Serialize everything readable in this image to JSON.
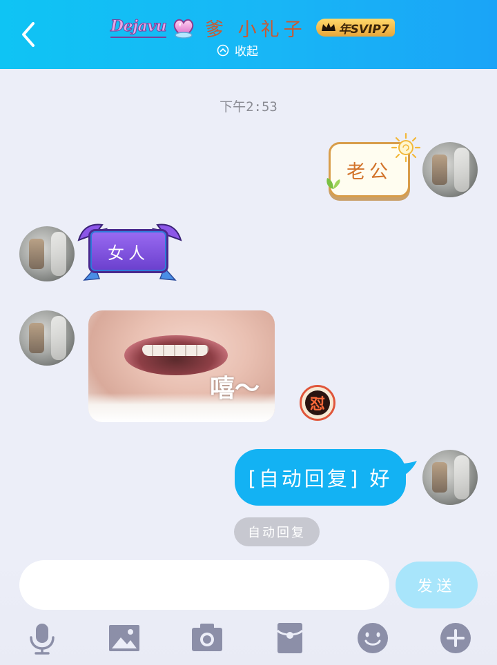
{
  "header": {
    "badge_text": "Dejavu",
    "contact_name": "爹 小礼子",
    "svip_label": "年SVIP7",
    "collapse_label": "收起"
  },
  "chat": {
    "timestamp": "下午2:53",
    "messages": [
      {
        "side": "right",
        "type": "sticker-bubble",
        "text": "老公"
      },
      {
        "side": "left",
        "type": "sticker-bubble",
        "text": "女人"
      },
      {
        "side": "left",
        "type": "image",
        "caption": "嘻～"
      },
      {
        "side": "right",
        "type": "text",
        "text": "[自动回复] 好"
      }
    ],
    "reaction_glyph": "怼",
    "auto_reply_tag": "自动回复"
  },
  "input": {
    "placeholder": "",
    "value": "",
    "send_label": "发送"
  },
  "toolbar": [
    "microphone-icon",
    "picture-icon",
    "camera-icon",
    "red-packet-icon",
    "emoji-icon",
    "plus-icon"
  ],
  "colors": {
    "header_start": "#0fc4f4",
    "header_end": "#1aa4f7",
    "bubble_blue": "#13b2f3",
    "send_button": "#a8e5fb",
    "background": "#eceef8",
    "icon_gray": "#8c8fa8"
  }
}
